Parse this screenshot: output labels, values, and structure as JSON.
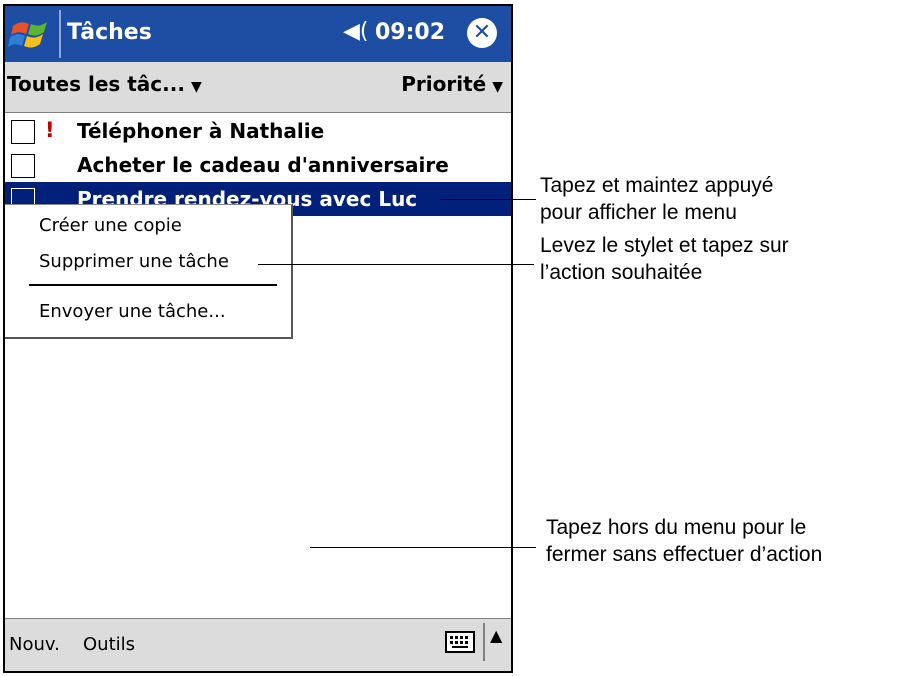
{
  "app": {
    "title": "Tâches",
    "time": "09:02",
    "speaker_icon": "◀",
    "close_icon": "✕"
  },
  "filter": {
    "category": "Toutes les tâc...",
    "sort": "Priorité",
    "caret": "▼"
  },
  "tasks": [
    {
      "priority": "!",
      "label": "Téléphoner à Nathalie"
    },
    {
      "priority": "",
      "label": "Acheter le cadeau d'anniversaire"
    },
    {
      "priority": "",
      "label": "Prendre rendez-vous avec Luc"
    }
  ],
  "context_menu": {
    "items": [
      "Créer une copie",
      "Supprimer une tâche",
      "Envoyer une tâche..."
    ]
  },
  "bottom_menu": {
    "new_label": "Nouv.",
    "tools_label": "Outils",
    "sip_arrow": "▲"
  },
  "callouts": {
    "tap_hold_line1": "Tapez et maintez appuyé",
    "tap_hold_line2": "pour afficher le menu",
    "lift_line1": "Levez le stylet et tapez sur",
    "lift_line2": "l’action souhaitée",
    "outside_line1": "Tapez hors du menu pour le",
    "outside_line2": "fermer sans effectuer d’action"
  },
  "colors": {
    "titlebar": "#1d4ea3",
    "selection": "#00207a",
    "priority": "#c00000"
  }
}
